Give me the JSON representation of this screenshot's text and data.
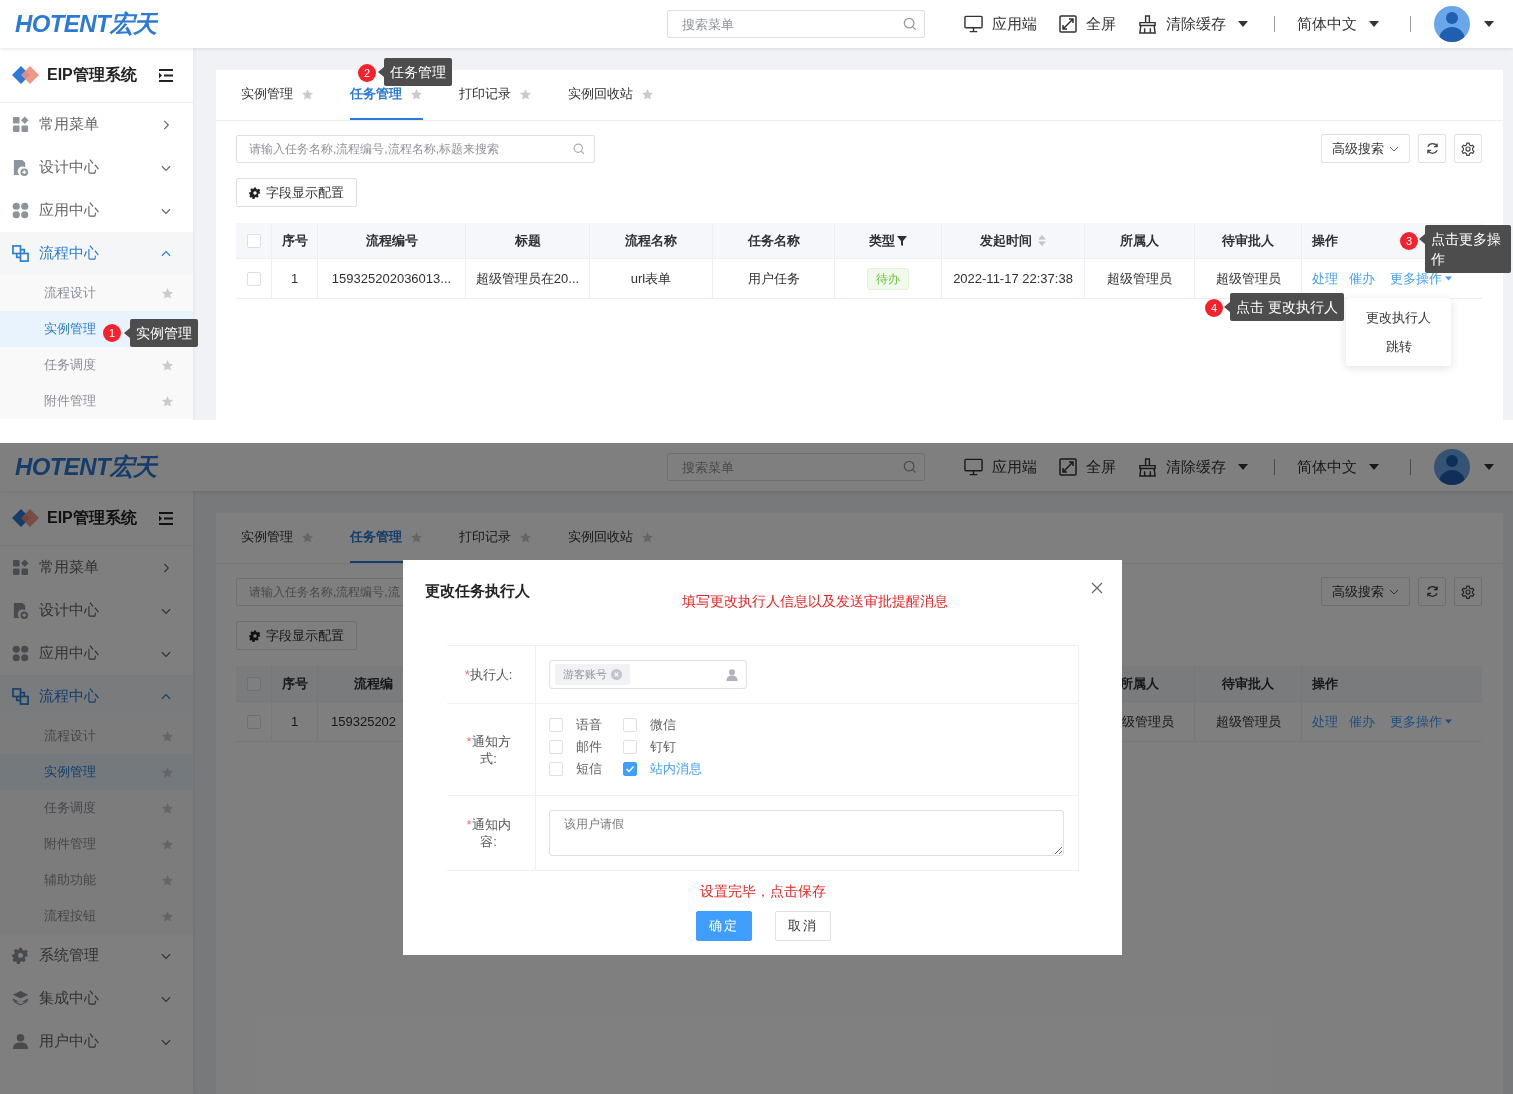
{
  "panels": [
    {
      "kind": "task_list",
      "header": {
        "logo": "HOTENT宏天",
        "search_placeholder": "搜索菜单",
        "actions": [
          {
            "label": "应用端",
            "dropdown": false
          },
          {
            "label": "全屏",
            "dropdown": false
          },
          {
            "label": "清除缓存",
            "dropdown": true
          }
        ],
        "language": "简体中文"
      },
      "sidebar": {
        "title": "EIP管理系统",
        "items": [
          {
            "label": "常用菜单",
            "kind": "flyout",
            "selected": false
          },
          {
            "label": "设计中心",
            "kind": "submenu",
            "expanded": false,
            "selected": false
          },
          {
            "label": "应用中心",
            "kind": "submenu",
            "expanded": false,
            "selected": false
          },
          {
            "label": "流程中心",
            "kind": "submenu",
            "expanded": true,
            "selected": true,
            "children": [
              {
                "label": "流程设计",
                "selected": false,
                "star": true
              },
              {
                "label": "实例管理",
                "selected": true,
                "star": false
              },
              {
                "label": "任务调度",
                "selected": false,
                "star": true
              },
              {
                "label": "附件管理",
                "selected": false,
                "star": true
              }
            ]
          }
        ]
      },
      "tabs": [
        {
          "label": "实例管理",
          "selected": false
        },
        {
          "label": "任务管理",
          "selected": true
        },
        {
          "label": "打印记录",
          "selected": false
        },
        {
          "label": "实例回收站",
          "selected": false
        }
      ],
      "search_placeholder": "请输入任务名称,流程编号,流程名称,标题来搜索",
      "advanced_search": "高级搜索",
      "field_config": "字段显示配置",
      "table": {
        "select_all_checked": false,
        "columns": [
          {
            "label": "序号",
            "kind": "plain"
          },
          {
            "label": "流程编号",
            "kind": "plain"
          },
          {
            "label": "标题",
            "kind": "plain"
          },
          {
            "label": "流程名称",
            "kind": "plain"
          },
          {
            "label": "任务名称",
            "kind": "plain"
          },
          {
            "label": "类型",
            "kind": "filter"
          },
          {
            "label": "发起时间",
            "kind": "sort"
          },
          {
            "label": "所属人",
            "kind": "plain"
          },
          {
            "label": "待审批人",
            "kind": "plain"
          },
          {
            "label": "操作",
            "kind": "plain"
          }
        ],
        "rows": [
          {
            "checked": false,
            "cells": [
              {
                "kind": "text",
                "text": "1"
              },
              {
                "kind": "text",
                "text": "159325202036013..."
              },
              {
                "kind": "text",
                "text": "超级管理员在20..."
              },
              {
                "kind": "text",
                "text": "url表单"
              },
              {
                "kind": "text",
                "text": "用户任务"
              },
              {
                "kind": "tag",
                "text": "待办"
              },
              {
                "kind": "text",
                "text": "2022-11-17 22:37:38"
              },
              {
                "kind": "text",
                "text": "超级管理员"
              },
              {
                "kind": "text",
                "text": "超级管理员"
              },
              {
                "kind": "actions",
                "links": [
                  "处理",
                  "催办"
                ],
                "more": "更多操作"
              }
            ]
          }
        ]
      },
      "dropdown": {
        "items": [
          "更改执行人",
          "跳转"
        ]
      },
      "annotations": [
        {
          "number": "1",
          "text": "实例管理"
        },
        {
          "number": "2",
          "text": "任务管理"
        },
        {
          "number": "3",
          "text": "点击更多操作"
        },
        {
          "number": "4",
          "text": "点击 更改执行人"
        }
      ]
    },
    {
      "kind": "task_list_dialog",
      "header": {
        "logo": "HOTENT宏天",
        "search_placeholder": "搜索菜单",
        "actions": [
          {
            "label": "应用端",
            "dropdown": false
          },
          {
            "label": "全屏",
            "dropdown": false
          },
          {
            "label": "清除缓存",
            "dropdown": true
          }
        ],
        "language": "简体中文"
      },
      "sidebar": {
        "title": "EIP管理系统",
        "items": [
          {
            "label": "常用菜单",
            "kind": "flyout",
            "selected": false
          },
          {
            "label": "设计中心",
            "kind": "submenu",
            "expanded": false,
            "selected": false
          },
          {
            "label": "应用中心",
            "kind": "submenu",
            "expanded": false,
            "selected": false
          },
          {
            "label": "流程中心",
            "kind": "submenu",
            "expanded": true,
            "selected": true,
            "children": [
              {
                "label": "流程设计",
                "selected": false,
                "star": true
              },
              {
                "label": "实例管理",
                "selected": true,
                "star": true
              },
              {
                "label": "任务调度",
                "selected": false,
                "star": true
              },
              {
                "label": "附件管理",
                "selected": false,
                "star": true
              },
              {
                "label": "辅助功能",
                "selected": false,
                "star": true
              },
              {
                "label": "流程按钮",
                "selected": false,
                "star": true
              }
            ]
          },
          {
            "label": "系统管理",
            "kind": "submenu",
            "expanded": false,
            "selected": false
          },
          {
            "label": "集成中心",
            "kind": "submenu",
            "expanded": false,
            "selected": false
          },
          {
            "label": "用户中心",
            "kind": "submenu",
            "expanded": false,
            "selected": false
          }
        ]
      },
      "tabs": [
        {
          "label": "实例管理",
          "selected": false
        },
        {
          "label": "任务管理",
          "selected": true
        },
        {
          "label": "打印记录",
          "selected": false
        },
        {
          "label": "实例回收站",
          "selected": false
        }
      ],
      "search_placeholder": "请输入任务名称,流程编号,流",
      "advanced_search": "高级搜索",
      "field_config": "字段显示配置",
      "table": {
        "select_all_checked": false,
        "columns": [
          {
            "label": "序号",
            "kind": "plain"
          },
          {
            "label": "流程编",
            "kind": "plain"
          },
          {
            "label": "所属人",
            "kind": "plain"
          },
          {
            "label": "待审批人",
            "kind": "plain"
          },
          {
            "label": "操作",
            "kind": "plain"
          }
        ],
        "rows": [
          {
            "checked": false,
            "cells": [
              {
                "kind": "text",
                "text": "1"
              },
              {
                "kind": "text",
                "text": "159325202"
              },
              {
                "kind": "text",
                "text": "级管理员"
              },
              {
                "kind": "text",
                "text": "超级管理员"
              },
              {
                "kind": "actions",
                "links": [
                  "处理",
                  "催办"
                ],
                "more": "更多操作"
              }
            ]
          }
        ]
      },
      "dialog": {
        "title": "更改任务执行人",
        "note": "填写更改执行人信息以及发送审批提醒消息",
        "fields": [
          {
            "kind": "user_select",
            "label": "执行人:",
            "required_mark": "*",
            "tags": [
              "游客账号"
            ]
          },
          {
            "kind": "checkboxes",
            "label": "通知方式:",
            "required_mark": "*",
            "options": [
              {
                "label": "语音",
                "checked": false
              },
              {
                "label": "微信",
                "checked": false
              },
              {
                "label": "邮件",
                "checked": false
              },
              {
                "label": "钉钉",
                "checked": false
              },
              {
                "label": "短信",
                "checked": false
              },
              {
                "label": "站内消息",
                "checked": true
              }
            ]
          },
          {
            "kind": "textarea",
            "label": "通知内容:",
            "required_mark": "*",
            "value": "该用户请假"
          }
        ],
        "hint": "设置完毕，点击保存",
        "buttons": [
          {
            "label": "确定",
            "kind": "primary"
          },
          {
            "label": "取消",
            "kind": "default"
          }
        ]
      }
    }
  ]
}
